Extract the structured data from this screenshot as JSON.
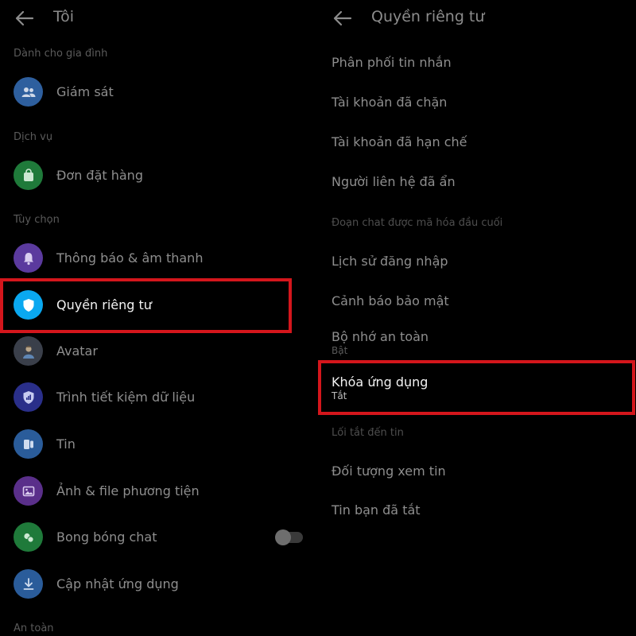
{
  "left": {
    "title": "Tôi",
    "sections": [
      {
        "label": "Dành cho gia đình"
      },
      {
        "label": "Dịch vụ"
      },
      {
        "label": "Tùy chọn"
      },
      {
        "label": "An toàn"
      }
    ],
    "items": [
      {
        "label": "Giám sát",
        "icon": "people-icon",
        "color": "#2e5f9e"
      },
      {
        "label": "Đơn đặt hàng",
        "icon": "shopping-bag-icon",
        "color": "#1f7a3a"
      },
      {
        "label": "Thông báo & âm thanh",
        "icon": "bell-icon",
        "color": "#5b3a9e"
      },
      {
        "label": "Quyền riêng tư",
        "icon": "shield-icon",
        "color": "#0aa8f0"
      },
      {
        "label": "Avatar",
        "icon": "avatar-icon",
        "color": "#3a3f4a"
      },
      {
        "label": "Trình tiết kiệm dữ liệu",
        "icon": "data-saver-icon",
        "color": "#2a2f8a"
      },
      {
        "label": "Tin",
        "icon": "stories-icon",
        "color": "#2a5c9a"
      },
      {
        "label": "Ảnh & file phương tiện",
        "icon": "image-icon",
        "color": "#5a2f8a"
      },
      {
        "label": "Bong bóng chat",
        "icon": "chat-bubbles-icon",
        "color": "#1f7a3a"
      },
      {
        "label": "Cập nhật ứng dụng",
        "icon": "download-icon",
        "color": "#2a5c9a"
      }
    ]
  },
  "right": {
    "title": "Quyền riêng tư",
    "items": [
      {
        "label": "Phân phối tin nhắn"
      },
      {
        "label": "Tài khoản đã chặn"
      },
      {
        "label": "Tài khoản đã hạn chế"
      },
      {
        "label": "Người liên hệ đã ẩn"
      },
      {
        "section": "Đoạn chat được mã hóa đầu cuối"
      },
      {
        "label": "Lịch sử đăng nhập"
      },
      {
        "label": "Cảnh báo bảo mật"
      },
      {
        "label": "Bộ nhớ an toàn",
        "sub": "Bật"
      },
      {
        "label": "Khóa ứng dụng",
        "sub": "Tắt"
      },
      {
        "section": "Lối tắt đến tin"
      },
      {
        "label": "Đối tượng xem tin"
      },
      {
        "label": "Tin bạn đã tắt"
      }
    ]
  },
  "theme": {
    "background": "#000000",
    "highlight": "#d4161c",
    "bubbles_toggle_on": false
  }
}
